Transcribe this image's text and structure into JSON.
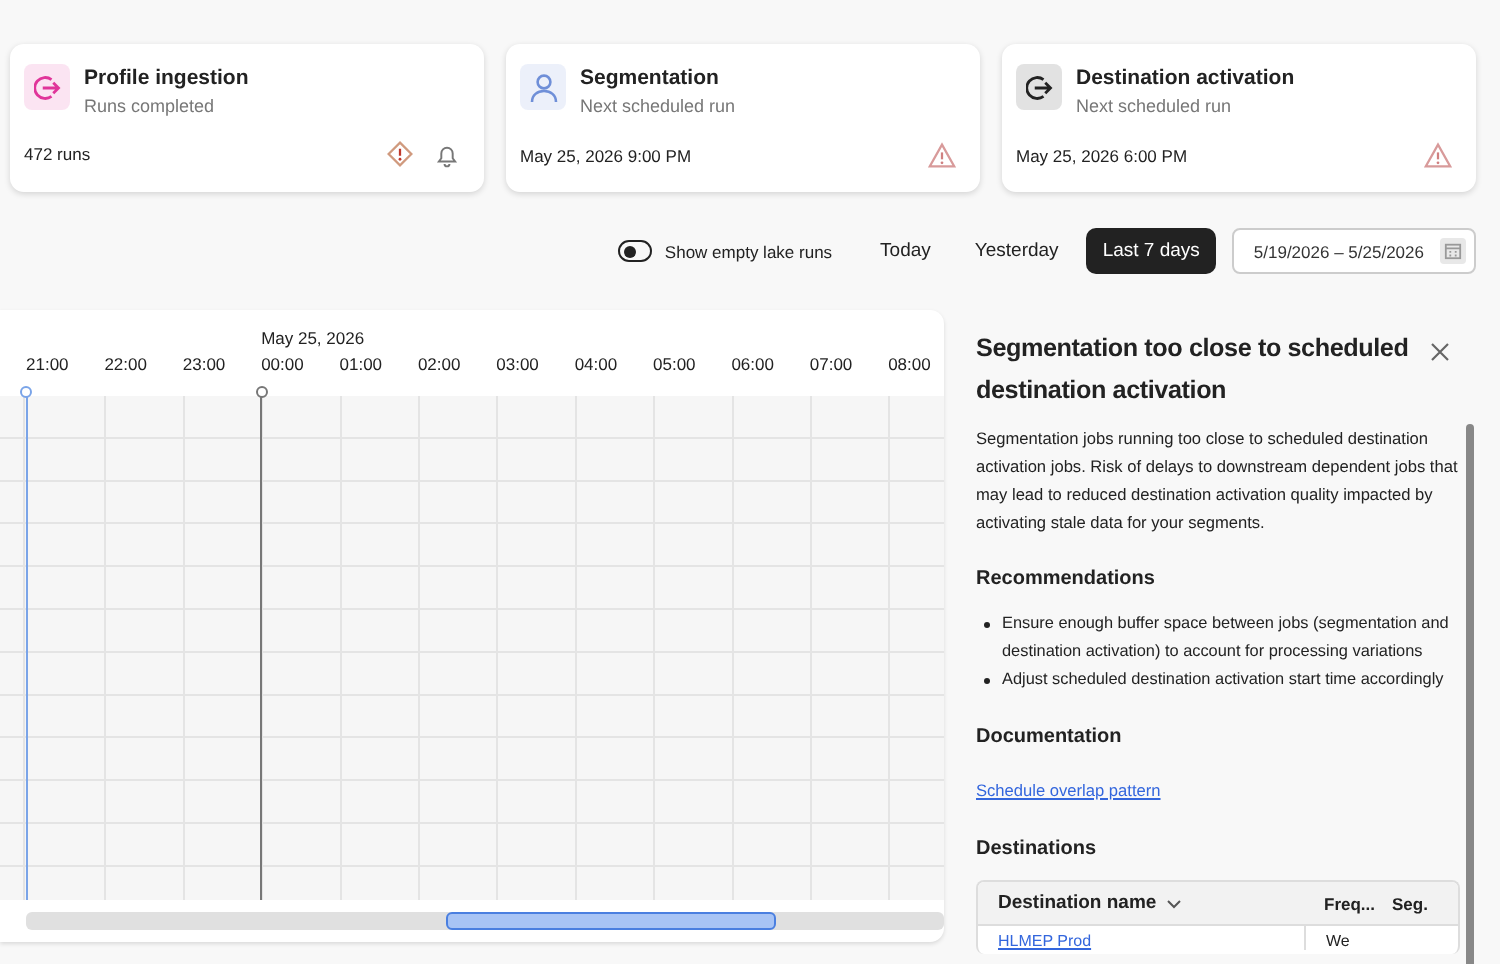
{
  "cards": [
    {
      "kind": "ingest",
      "color": "#e0359a",
      "title": "Profile ingestion",
      "subtitle": "Runs completed",
      "value": "472 runs",
      "indicators": [
        {
          "kind": "diamond-alert"
        },
        {
          "kind": "bell"
        }
      ]
    },
    {
      "kind": "person",
      "color": "#6f8fd8",
      "title": "Segmentation",
      "subtitle": "Next scheduled run",
      "value": "May 25, 2026 9:00 PM",
      "indicators": [
        {
          "kind": "triangle-alert"
        }
      ]
    },
    {
      "kind": "activate",
      "color": "#222222",
      "title": "Destination activation",
      "subtitle": "Next scheduled run",
      "value": "May 25, 2026 6:00 PM",
      "indicators": [
        {
          "kind": "triangle-alert"
        }
      ]
    }
  ],
  "toolbar": {
    "toggle": {
      "label": "Show empty lake runs",
      "on": false
    },
    "ranges": [
      {
        "label": "Today",
        "selected": false
      },
      {
        "label": "Yesterday",
        "selected": false
      },
      {
        "label": "Last 7 days",
        "selected": true
      }
    ],
    "date_range": "5/19/2026 – 5/25/2026"
  },
  "timeline": {
    "hours": [
      {
        "label": "21:00",
        "current": true,
        "day_start": false
      },
      {
        "label": "22:00",
        "current": false,
        "day_start": false
      },
      {
        "label": "23:00",
        "current": false,
        "day_start": false
      },
      {
        "label": "00:00",
        "date": "May 25, 2026",
        "current": false,
        "day_start": true
      },
      {
        "label": "01:00",
        "current": false,
        "day_start": false
      },
      {
        "label": "02:00",
        "current": false,
        "day_start": false
      },
      {
        "label": "03:00",
        "current": false,
        "day_start": false
      },
      {
        "label": "04:00",
        "current": false,
        "day_start": false
      },
      {
        "label": "05:00",
        "current": false,
        "day_start": false
      },
      {
        "label": "06:00",
        "current": false,
        "day_start": false
      },
      {
        "label": "07:00",
        "current": false,
        "day_start": false
      },
      {
        "label": "08:00",
        "current": false,
        "day_start": false
      }
    ]
  },
  "panel": {
    "title": "Segmentation too close to scheduled destination activation",
    "description": "Segmentation jobs running too close to scheduled destination activation jobs. Risk of delays to downstream dependent jobs that may lead to reduced destination activation quality impacted by activating stale data for your segments.",
    "recommendations": {
      "heading": "Recommendations",
      "items": [
        "Ensure enough buffer space between jobs (segmentation and destination activation) to account for processing variations",
        "Adjust scheduled destination activation start time accordingly"
      ]
    },
    "documentation": {
      "heading": "Documentation",
      "link": "Schedule overlap pattern"
    },
    "destinations": {
      "heading": "Destinations",
      "columns": [
        {
          "label": "Destination name",
          "sortable": true
        },
        {
          "label": "Freq...",
          "sortable": false
        },
        {
          "label": "Seg.",
          "sortable": false
        }
      ],
      "rows": [
        [
          "HLMEP Prod",
          "We"
        ]
      ]
    }
  }
}
